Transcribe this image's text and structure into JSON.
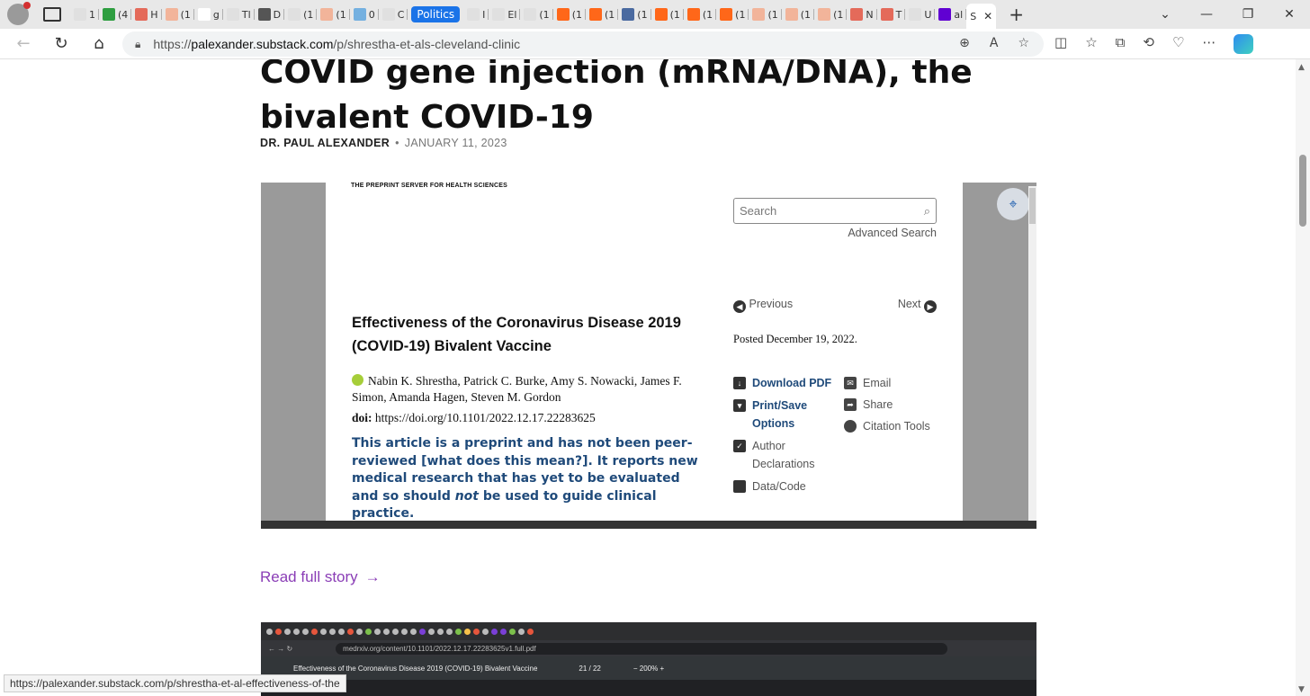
{
  "browser": {
    "tabs": [
      {
        "label": "1",
        "color": "#e0e0e0"
      },
      {
        "label": "(4",
        "color": "#2e9e40"
      },
      {
        "label": "H",
        "color": "#e46a5a"
      },
      {
        "label": "(1",
        "color": "#f2b49a"
      },
      {
        "label": "g",
        "color": "#ffffff"
      },
      {
        "label": "Tl",
        "color": "#e0e0e0"
      },
      {
        "label": "D",
        "color": "#555555"
      },
      {
        "label": "(1",
        "color": "#e0e0e0"
      },
      {
        "label": "(1",
        "color": "#f2b49a"
      },
      {
        "label": "0",
        "color": "#74b0e0"
      },
      {
        "label": "C",
        "color": "#e0e0e0"
      }
    ],
    "tab_group_label": "Politics",
    "tabs_after_group": [
      {
        "label": "I",
        "color": "#e0e0e0"
      },
      {
        "label": "El",
        "color": "#e0e0e0"
      },
      {
        "label": "(1",
        "color": "#e0e0e0"
      },
      {
        "label": "(1",
        "color": "#ff6719"
      },
      {
        "label": "(1",
        "color": "#ff6719"
      },
      {
        "label": "(1",
        "color": "#4a6aa0"
      },
      {
        "label": "(1",
        "color": "#ff6719"
      },
      {
        "label": "(1",
        "color": "#ff6719"
      },
      {
        "label": "(1",
        "color": "#ff6719"
      },
      {
        "label": "(1",
        "color": "#f2b49a"
      },
      {
        "label": "(1",
        "color": "#f2b49a"
      },
      {
        "label": "(1",
        "color": "#f2b49a"
      },
      {
        "label": "N",
        "color": "#e46a5a"
      },
      {
        "label": "T",
        "color": "#e46a5a"
      },
      {
        "label": "U",
        "color": "#e0e0e0"
      },
      {
        "label": "al",
        "color": "#6001d2"
      }
    ],
    "active_tab_label": "S",
    "url_prefix": "https://",
    "url_domain": "palexander.substack.com",
    "url_path": "/p/shrestha-et-als-cleveland-clinic",
    "status_url": "https://palexander.substack.com/p/shrestha-et-al-effectiveness-of-the"
  },
  "article": {
    "title": "COVID gene injection (mRNA/DNA), the bivalent COVID-19",
    "author": "DR. PAUL ALEXANDER",
    "separator": "•",
    "date": "JANUARY 11, 2023",
    "read_full_story": "Read full story",
    "read_arrow": "→"
  },
  "preprint": {
    "server_label": "THE PREPRINT SERVER FOR HEALTH SCIENCES",
    "search_placeholder": "Search",
    "advanced_search": "Advanced Search",
    "previous": "Previous",
    "next": "Next",
    "paper_title": "Effectiveness of the Coronavirus Disease 2019 (COVID-19) Bivalent Vaccine",
    "authors": "Nabin K. Shrestha, Patrick C. Burke, Amy S. Nowacki, James F. Simon, Amanda Hagen, Steven M. Gordon",
    "doi_label": "doi:",
    "doi_value": "https://doi.org/10.1101/2022.12.17.22283625",
    "notice_part1": "This article is a preprint and has not been peer-reviewed [what does this mean?]. It reports new medical research that has yet to be evaluated and so should ",
    "notice_not": "not",
    "notice_part2": " be used to guide clinical practice.",
    "posted": "Posted December 19, 2022.",
    "actions_left": [
      "Download PDF",
      "Print/Save Options",
      "Author Declarations",
      "Data/Code"
    ],
    "actions_right": [
      "Email",
      "Share",
      "Citation Tools"
    ]
  },
  "embed2": {
    "url": "medrxiv.org/content/10.1101/2022.12.17.22283625v1.full.pdf",
    "pdf_title": "Effectiveness of the Coronavirus Disease 2019 (COVID-19) Bivalent Vaccine",
    "page_current": "21",
    "page_total": "/ 22",
    "zoom": "200%"
  }
}
